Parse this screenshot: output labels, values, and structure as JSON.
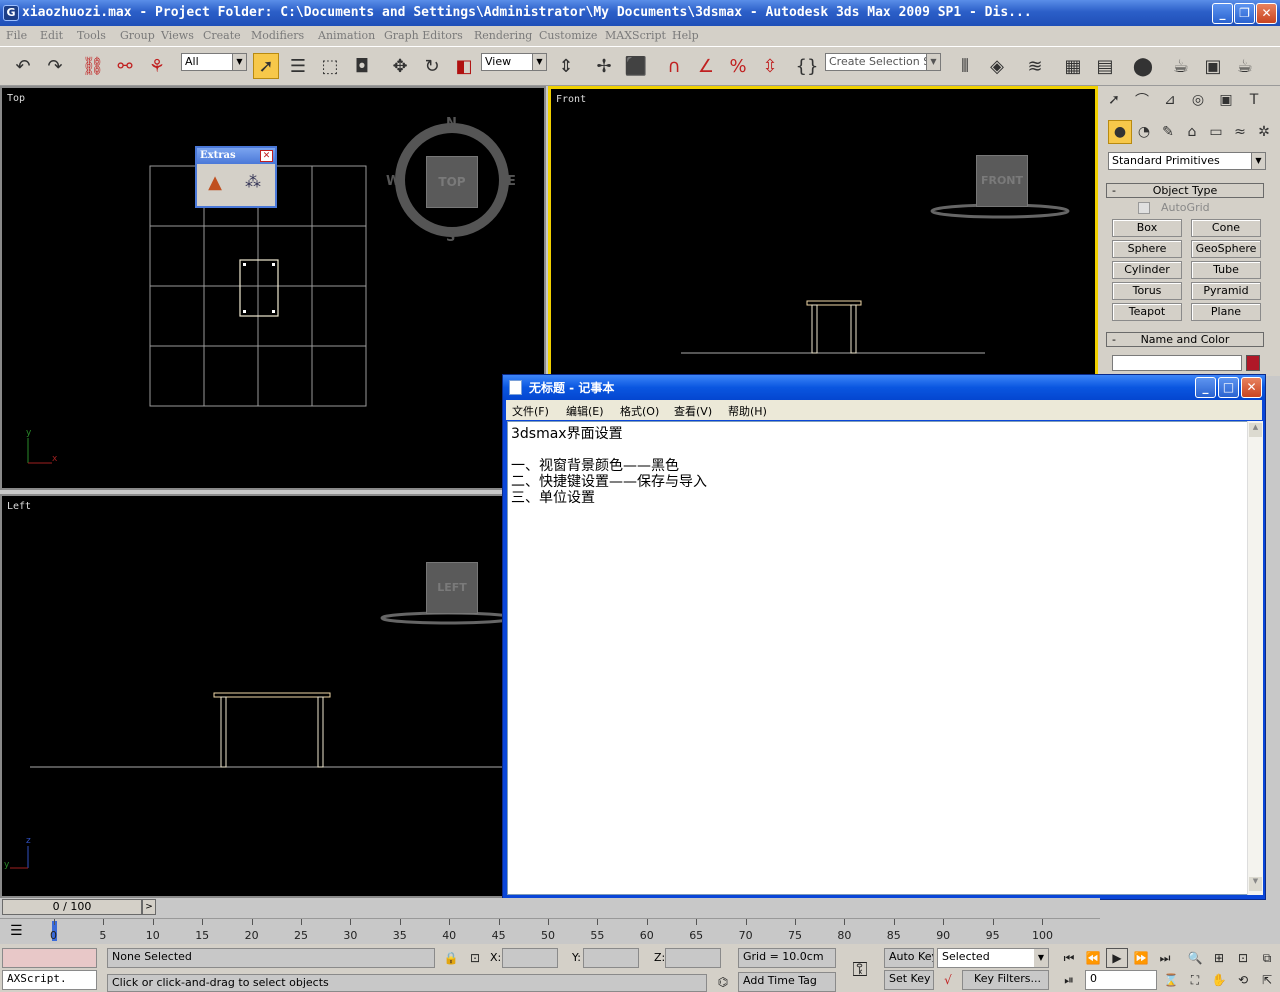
{
  "window": {
    "title": "xiaozhuozi.max     - Project Folder: C:\\Documents and Settings\\Administrator\\My Documents\\3dsmax     - Autodesk 3ds Max  2009 SP1     - Dis..."
  },
  "menu": [
    "File",
    "Edit",
    "Tools",
    "Group",
    "Views",
    "Create",
    "Modifiers",
    "Animation",
    "Graph Editors",
    "Rendering",
    "Customize",
    "MAXScript",
    "Help"
  ],
  "toolbar": {
    "filter": "All",
    "coord": "View",
    "selection_set": "Create Selection Set"
  },
  "viewports": {
    "top": {
      "label": "Top",
      "cube": "TOP",
      "compass": {
        "n": "N",
        "s": "S",
        "w": "W",
        "e": "E"
      },
      "axis_y": "y",
      "axis_x": "x"
    },
    "front": {
      "label": "Front",
      "cube": "FRONT"
    },
    "left": {
      "label": "Left",
      "cube": "LEFT",
      "axis_z": "z",
      "axis_y": "y"
    }
  },
  "extras": {
    "title": "Extras"
  },
  "command_panel": {
    "category": "Standard Primitives",
    "object_type": "Object Type",
    "autogrid": "AutoGrid",
    "primitives": [
      "Box",
      "Cone",
      "Sphere",
      "GeoSphere",
      "Cylinder",
      "Tube",
      "Torus",
      "Pyramid",
      "Teapot",
      "Plane"
    ],
    "name_and_color": "Name and Color",
    "color": "#b01828"
  },
  "notepad": {
    "title": "无标题 - 记事本",
    "menu": [
      "文件(F)",
      "编辑(E)",
      "格式(O)",
      "查看(V)",
      "帮助(H)"
    ],
    "text": "3dsmax界面设置\n\n一、视窗背景颜色——黑色\n二、快捷键设置——保存与导入\n三、单位设置"
  },
  "timeline": {
    "slider": "0 / 100",
    "ticks": [
      "0",
      "5",
      "10",
      "15",
      "20",
      "25",
      "30",
      "35",
      "40",
      "45",
      "50",
      "55",
      "60",
      "65",
      "70",
      "75",
      "80",
      "85",
      "90",
      "95",
      "100"
    ]
  },
  "status": {
    "maxscript": "AXScript.",
    "selection": "None Selected",
    "prompt": "Click or click-and-drag to select objects",
    "x_label": "X:",
    "y_label": "Y:",
    "z_label": "Z:",
    "grid": "Grid = 10.0cm",
    "add_time_tag": "Add Time Tag",
    "auto_key": "Auto Key",
    "set_key": "Set Key",
    "key_mode": "Selected",
    "key_filters": "Key Filters...",
    "frame": "0"
  }
}
